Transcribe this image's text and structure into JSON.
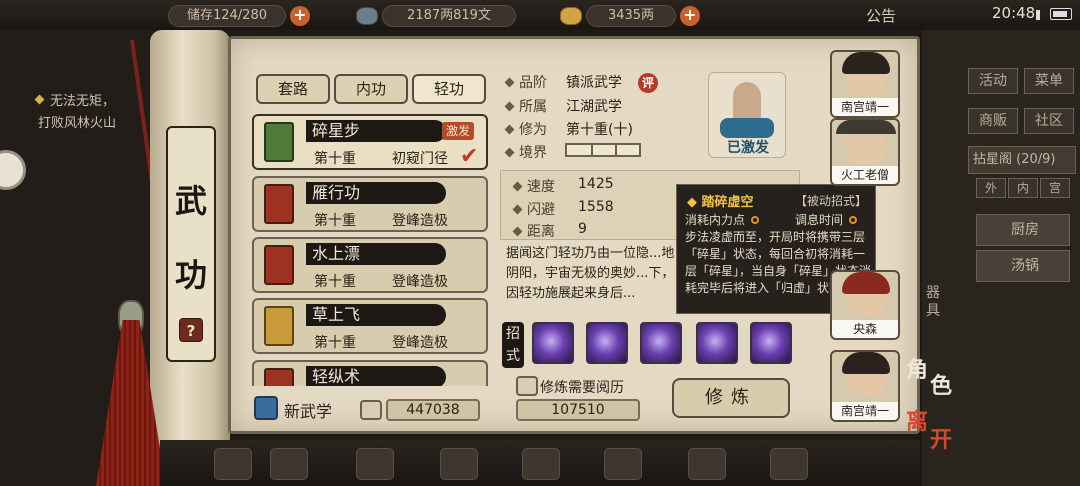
{
  "topbar": {
    "storage": "储存124/280",
    "money": "2187两819文",
    "gold": "3435两",
    "notice": "公告",
    "clock": "20:48"
  },
  "quest": {
    "title": "无法无矩，",
    "desc": "打败风林火山"
  },
  "scroll": {
    "title_chars": [
      "武",
      "功"
    ],
    "help": "?"
  },
  "tabs": [
    "套路",
    "内功",
    "轻功"
  ],
  "skills": [
    {
      "name": "碎星步",
      "level": "第十重",
      "stage": "初窥门径",
      "tag": "激发"
    },
    {
      "name": "雁行功",
      "level": "第十重",
      "stage": "登峰造极"
    },
    {
      "name": "水上漂",
      "level": "第十重",
      "stage": "登峰造极"
    },
    {
      "name": "草上飞",
      "level": "第十重",
      "stage": "登峰造极"
    },
    {
      "name": "轻纵术"
    }
  ],
  "footer": {
    "new_skill": "新武学",
    "reading_left": "447038",
    "practice_need": "修炼需要阅历",
    "practice_value": "107510",
    "practice_btn": "修炼"
  },
  "detail": {
    "grade_label": "品阶",
    "grade": "镇派武学",
    "grade_badge": "评",
    "belong_label": "所属",
    "belong": "江湖武学",
    "cultivate_label": "修为",
    "cultivate": "第十重(十)",
    "realm_label": "境界",
    "activated": "已激发",
    "speed_label": "速度",
    "speed": "1425",
    "dodge_label": "闪避",
    "dodge": "1558",
    "range_label": "距离",
    "range": "9",
    "description": "据闻这门轻功乃由一位隐...地阴阳，宇宙无极的奥妙...下，因轻功施展起来身后...",
    "moves_label": "招式"
  },
  "tooltip": {
    "title": "踏碎虚空",
    "type": "【被动招式】",
    "cost": "消耗内力点",
    "cooldown": "调息时间",
    "desc": "步法凌虚而至，开局时将携带三层「碎星」状态，每回合初将消耗一层「碎星」，当自身「碎星」状态消耗完毕后将进入「归虚」状态。"
  },
  "party": [
    {
      "name": "南宫靖一"
    },
    {
      "name": "火工老僧"
    },
    {
      "name": "央森"
    },
    {
      "name": "南宫靖一"
    }
  ],
  "right_menu": {
    "row1": [
      "活动",
      "菜单"
    ],
    "row2": [
      "商贩",
      "社区"
    ],
    "pagoda": "拈星阁",
    "pagoda_count": "(20/9)",
    "tabs": [
      "外",
      "内",
      "宫"
    ],
    "kitchen": "厨房",
    "soup": "汤锅",
    "side_tag": "器具",
    "role_label": [
      "角",
      "色"
    ],
    "leave_label": [
      "离",
      "开"
    ]
  },
  "colors": {
    "accent_red": "#b34a2a",
    "tooltip_title": "#f0c04a",
    "paper": "#e4dac4"
  }
}
